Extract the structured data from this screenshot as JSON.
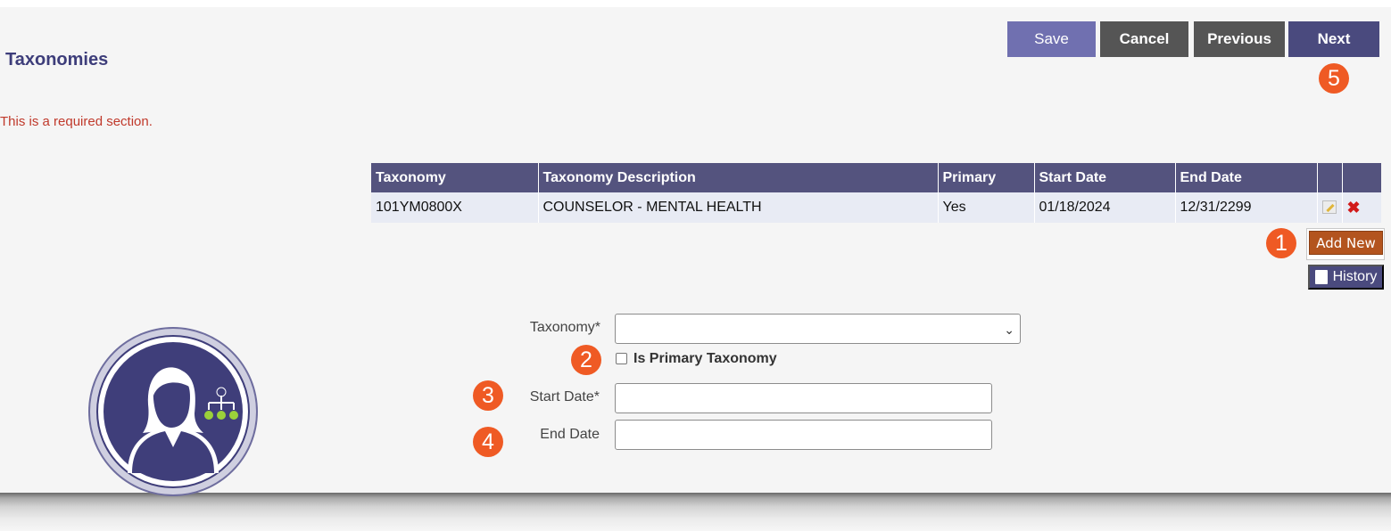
{
  "header": {
    "title": "Taxonomies"
  },
  "notice": "This is a required section.",
  "toolbar": {
    "save": "Save",
    "cancel": "Cancel",
    "previous": "Previous",
    "next": "Next"
  },
  "table": {
    "columns": [
      "Taxonomy",
      "Taxonomy Description",
      "Primary",
      "Start Date",
      "End Date"
    ],
    "rows": [
      {
        "taxonomy": "101YM0800X",
        "description": "COUNSELOR - MENTAL HEALTH",
        "primary": "Yes",
        "start_date": "01/18/2024",
        "end_date": "12/31/2299"
      }
    ]
  },
  "actions": {
    "add_new": "Add New",
    "history": "History"
  },
  "form": {
    "taxonomy_label": "Taxonomy*",
    "taxonomy_value": "",
    "primary_checkbox_label": "Is Primary Taxonomy",
    "start_date_label": "Start Date*",
    "start_date_value": "",
    "end_date_label": "End Date",
    "end_date_value": ""
  },
  "callouts": [
    "1",
    "2",
    "3",
    "4",
    "5"
  ],
  "colors": {
    "header": "#54537e",
    "accent_orange": "#ef5a24",
    "add_new": "#b3541e",
    "required_text": "#c0392b"
  },
  "icons": [
    "edit-icon",
    "delete-icon",
    "book-icon",
    "chevron-down-icon",
    "user-hierarchy-icon"
  ]
}
